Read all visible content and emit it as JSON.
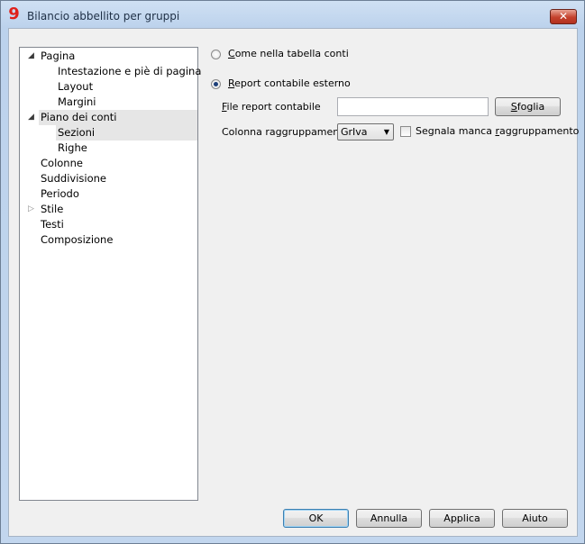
{
  "window": {
    "title": "Bilancio abbellito per gruppi",
    "app_icon_glyph": "9",
    "close_glyph": "✕",
    "accent_close": "#c4412d"
  },
  "tree": {
    "items": [
      {
        "label": "Pagina",
        "level": 0,
        "expander": "expanded"
      },
      {
        "label": "Intestazione e piè di pagina",
        "level": 1
      },
      {
        "label": "Layout",
        "level": 1
      },
      {
        "label": "Margini",
        "level": 1
      },
      {
        "label": "Piano dei conti",
        "level": 0,
        "expander": "expanded",
        "highlighted": true
      },
      {
        "label": "Sezioni",
        "level": 1,
        "selected": true
      },
      {
        "label": "Righe",
        "level": 1
      },
      {
        "label": "Colonne",
        "level": 0
      },
      {
        "label": "Suddivisione",
        "level": 0
      },
      {
        "label": "Periodo",
        "level": 0
      },
      {
        "label": "Stile",
        "level": 0,
        "expander": "collapsed"
      },
      {
        "label": "Testi",
        "level": 0
      },
      {
        "label": "Composizione",
        "level": 0
      }
    ]
  },
  "options": {
    "radio_table": {
      "label_prefix": "C",
      "label_rest": "ome nella tabella conti",
      "checked": false
    },
    "radio_external": {
      "label_prefix": "R",
      "label_rest": "eport contabile esterno",
      "checked": true
    },
    "file_label_prefix": "F",
    "file_label_rest": "ile report contabile",
    "file_value": "",
    "browse_prefix": "S",
    "browse_rest": "foglia",
    "group_col_label": "Colonna raggruppamento",
    "group_col_value": "GrIva",
    "missing_group_prefix": "Segnala manca ",
    "missing_group_mnemonic": "r",
    "missing_group_rest": "aggruppamento",
    "missing_group_checked": false
  },
  "footer": {
    "ok": "OK",
    "cancel": "Annulla",
    "apply": "Applica",
    "help": "Aiuto"
  }
}
